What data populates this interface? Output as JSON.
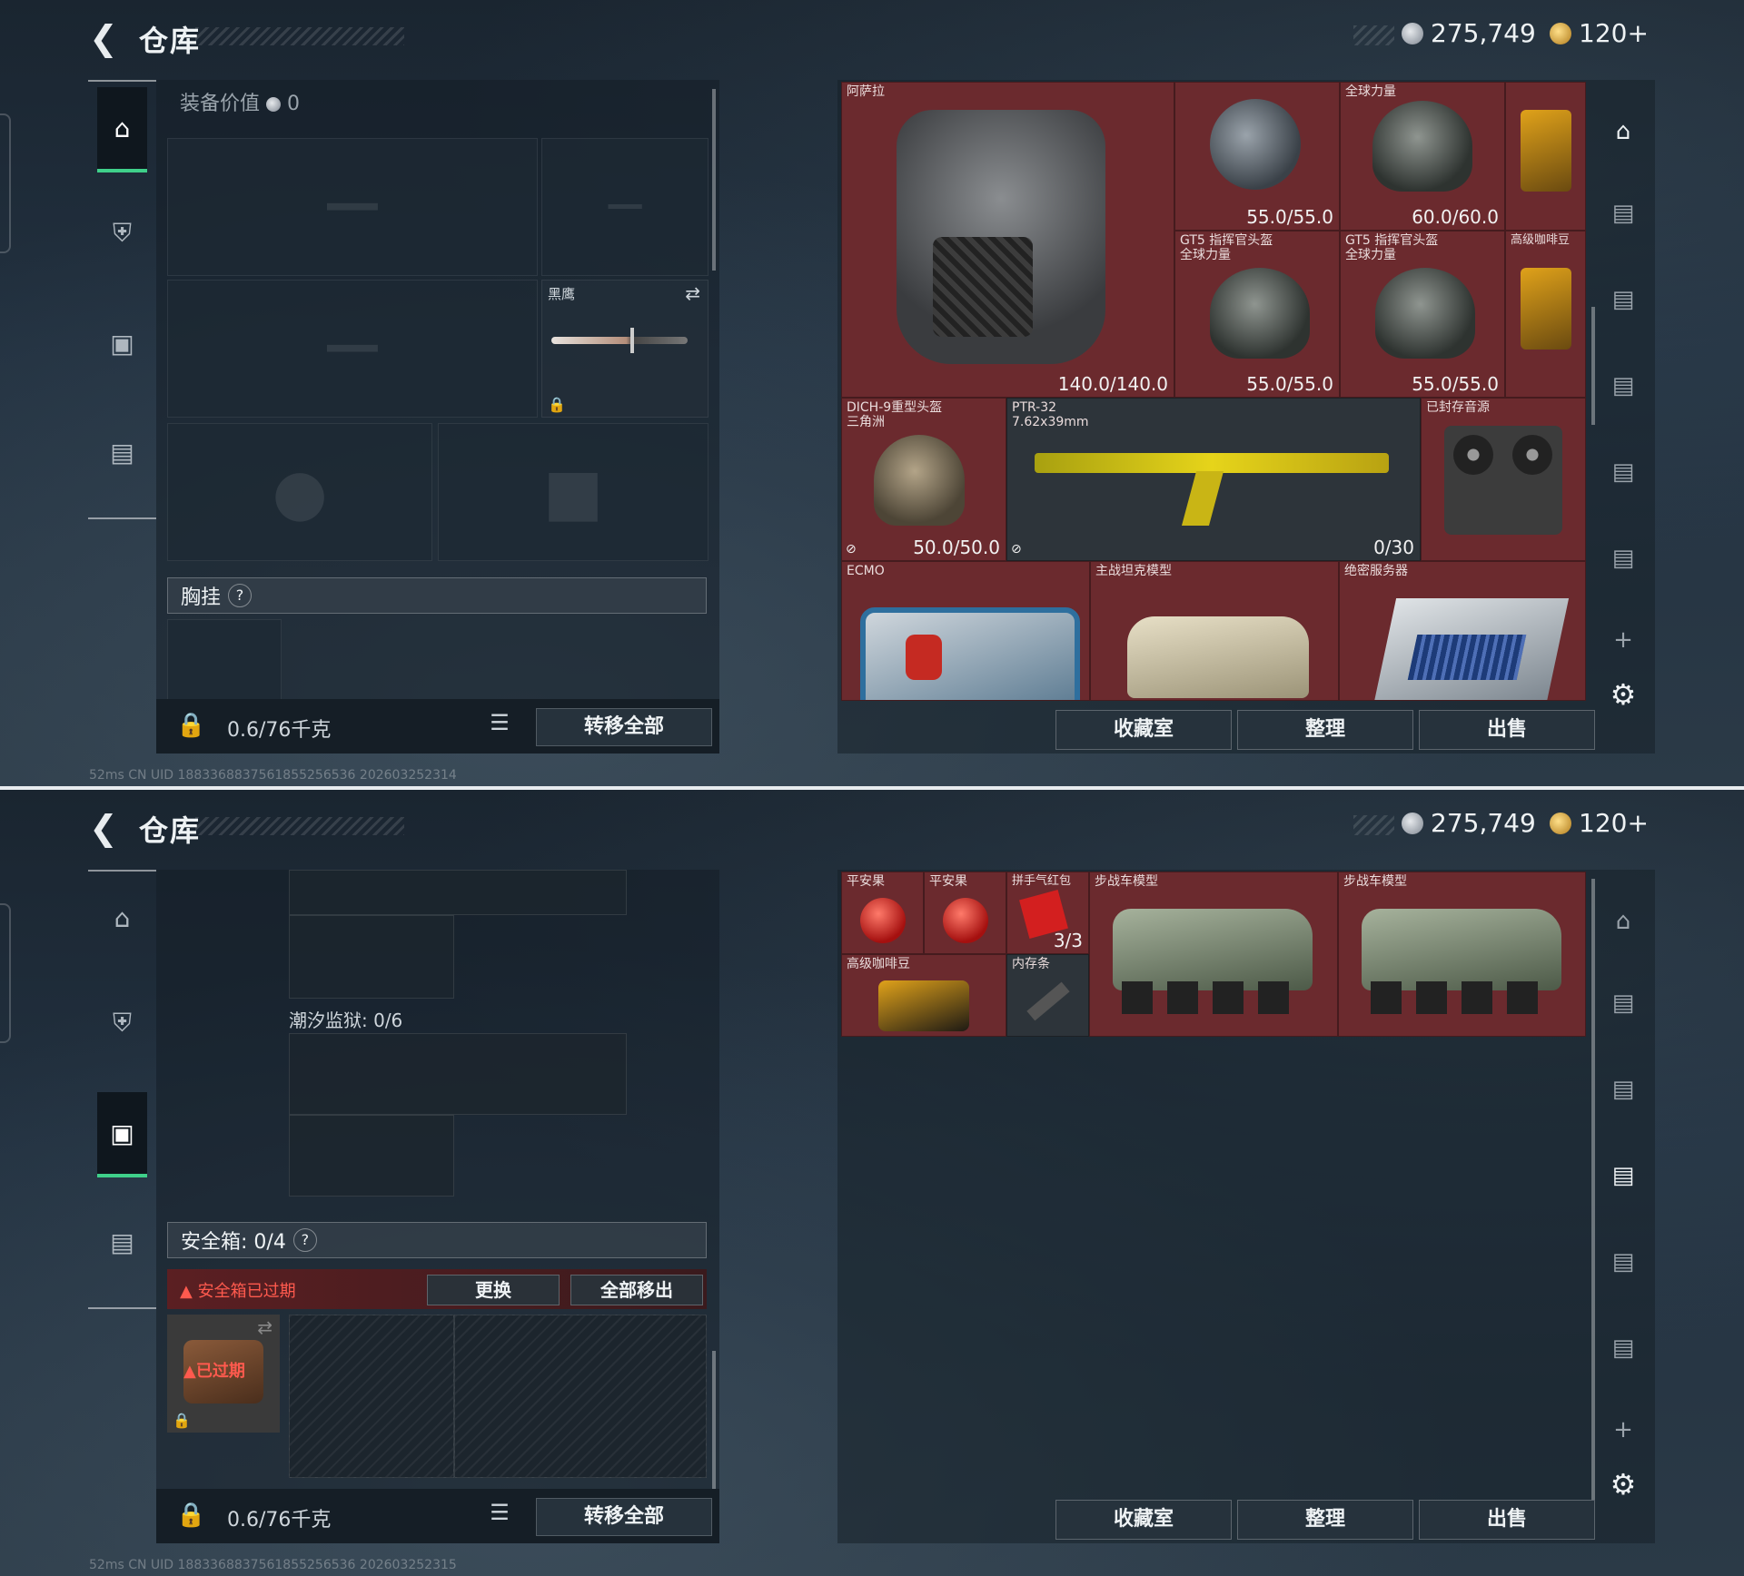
{
  "header": {
    "title": "仓库",
    "currency_silver": "275,749",
    "currency_gold": "120+"
  },
  "top": {
    "equipment_value_label": "装备价值",
    "equipment_value": "0",
    "melee_name": "黑鹰",
    "chest_rig_label": "胸挂",
    "weight": "0.6/76千克",
    "transfer_all": "转移全部",
    "status": "52ms    CN UID 1883368837561855256536 202603252314",
    "items": [
      {
        "name": "阿萨拉",
        "durability": "140.0/140.0"
      },
      {
        "name": "",
        "durability": "55.0/55.0"
      },
      {
        "name": "全球力量",
        "durability": "60.0/60.0"
      },
      {
        "name": "GT5 指挥官头盔",
        "sub": "全球力量",
        "durability": "55.0/55.0"
      },
      {
        "name": "GT5 指挥官头盔",
        "sub": "全球力量",
        "durability": "55.0/55.0"
      },
      {
        "name": "高级咖啡豆"
      },
      {
        "name": "DICH-9重型头盔",
        "sub": "三角洲",
        "durability": "50.0/50.0"
      },
      {
        "name": "PTR-32",
        "sub": "7.62x39mm",
        "ammo": "0/30"
      },
      {
        "name": "已封存音源"
      },
      {
        "name": "ECMO"
      },
      {
        "name": "主战坦克模型"
      },
      {
        "name": "绝密服务器"
      }
    ]
  },
  "bottom": {
    "prison_label": "潮汐监狱: 0/6",
    "safebox_label": "安全箱: 0/4",
    "safebox_expired_warning": "安全箱已过期",
    "replace": "更换",
    "move_all_out": "全部移出",
    "expired_tag": "已过期",
    "weight": "0.6/76千克",
    "transfer_all": "转移全部",
    "status": "52ms    CN UID 1883368837561855256536 202603252315",
    "items": [
      {
        "name": "平安果"
      },
      {
        "name": "平安果"
      },
      {
        "name": "拼手气红包",
        "count": "3/3"
      },
      {
        "name": "步战车模型"
      },
      {
        "name": "步战车模型"
      },
      {
        "name": "高级咖啡豆"
      },
      {
        "name": "内存条"
      }
    ]
  },
  "buttons": {
    "collection": "收藏室",
    "organize": "整理",
    "sell": "出售"
  },
  "colors": {
    "accent": "#3fd08a",
    "stash_bg": "#62262a",
    "warning": "#ff5a4e"
  }
}
